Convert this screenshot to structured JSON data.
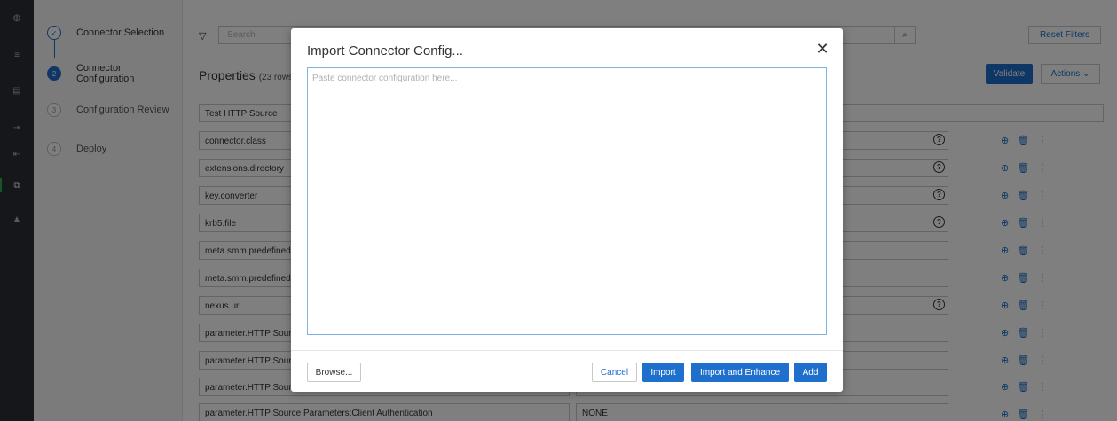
{
  "rail": {
    "icons": [
      "dashboard-icon",
      "list-icon",
      "database-icon",
      "export-icon",
      "import-icon",
      "connectors-icon",
      "alert-icon"
    ]
  },
  "stepper": {
    "steps": [
      {
        "number": "✓",
        "label": "Connector Selection",
        "state": "done"
      },
      {
        "number": "2",
        "label": "Connector Configuration",
        "state": "current"
      },
      {
        "number": "3",
        "label": "Configuration Review",
        "state": "pending"
      },
      {
        "number": "4",
        "label": "Deploy",
        "state": "pending"
      }
    ]
  },
  "toolbar": {
    "search_placeholder": "Search",
    "reset_filters_label": "Reset Filters"
  },
  "properties": {
    "title": "Properties",
    "row_count": "(23 rows)",
    "validate_label": "Validate",
    "actions_label": "Actions"
  },
  "rows": [
    {
      "key": "Test HTTP Source",
      "value": "",
      "help": false
    },
    {
      "key": "connector.class",
      "value": "",
      "help": true
    },
    {
      "key": "extensions.directory",
      "value": "",
      "help": true
    },
    {
      "key": "key.converter",
      "value": "",
      "help": true
    },
    {
      "key": "krb5.file",
      "value": "",
      "help": true
    },
    {
      "key": "meta.smm.predefined",
      "value": "",
      "help": false
    },
    {
      "key": "meta.smm.predefined",
      "value": "",
      "help": false
    },
    {
      "key": "nexus.url",
      "value": "",
      "help": true
    },
    {
      "key": "parameter.HTTP Source",
      "value": "",
      "help": false
    },
    {
      "key": "parameter.HTTP Source",
      "value": "",
      "help": false
    },
    {
      "key": "parameter.HTTP Source",
      "value": "",
      "help": false
    },
    {
      "key": "parameter.HTTP Source Parameters:Client Authentication",
      "value": "NONE",
      "help": false
    }
  ],
  "modal": {
    "title": "Import Connector Config...",
    "close_label": "✕",
    "textarea_placeholder": "Paste connector configuration here...",
    "browse_label": "Browse...",
    "cancel_label": "Cancel",
    "import_label": "Import",
    "import_enhance_label": "Import and Enhance",
    "add_label": "Add"
  },
  "colors": {
    "accent": "#1f6fcc",
    "rail_bg": "#2a2f36",
    "overlay": "rgba(0,0,0,0.5)"
  }
}
